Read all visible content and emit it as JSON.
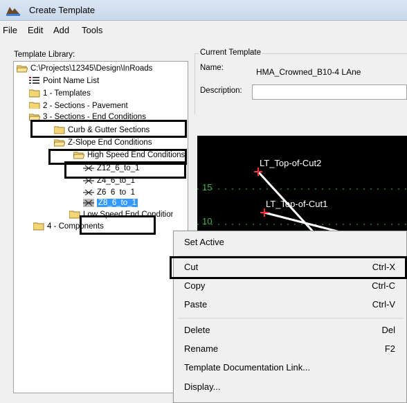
{
  "window": {
    "title": "Create Template"
  },
  "menu": [
    "File",
    "Edit",
    "Add",
    "Tools"
  ],
  "library": {
    "label": "Template Library:",
    "items": [
      "C:\\Projects\\12345\\Design\\InRoads",
      "Point Name List",
      "1 - Templates",
      "2 - Sections - Pavement",
      "3 - Sections - End Conditions",
      "Curb & Gutter Sections",
      "Z-Slope End Conditions",
      "High Speed End Conditions",
      "Z12_6_to_1",
      "Z4_6_to_1",
      "Z6_6_to_1",
      "Z8_6_to_1",
      "Low Speed End Conditions",
      "4 - Components"
    ]
  },
  "current": {
    "label": "Current Template",
    "name_label": "Name:",
    "name_value": "HMA_Crowned_B10-4 LAne",
    "desc_label": "Description:",
    "desc_value": ""
  },
  "canvas": {
    "labels": [
      "LT_Top-of-Cut2",
      "LT_Top-of-Cut1"
    ],
    "ticks": [
      "15",
      "10"
    ],
    "colors": {
      "background": "#000000",
      "grid": "#3fb34a",
      "line": "#ffffff",
      "point": "#ff3030"
    }
  },
  "context_menu": {
    "items": [
      {
        "label": "Set Active",
        "shortcut": ""
      },
      {
        "label": "Cut",
        "shortcut": "Ctrl-X"
      },
      {
        "label": "Copy",
        "shortcut": "Ctrl-C"
      },
      {
        "label": "Paste",
        "shortcut": "Ctrl-V"
      },
      {
        "label": "Delete",
        "shortcut": "Del"
      },
      {
        "label": "Rename",
        "shortcut": "F2"
      },
      {
        "label": "Template Documentation Link...",
        "shortcut": ""
      },
      {
        "label": "Display...",
        "shortcut": ""
      }
    ]
  },
  "colors": {
    "selection": "#3399ff",
    "highlight_box": "#000000",
    "folder": "#f2d675"
  }
}
